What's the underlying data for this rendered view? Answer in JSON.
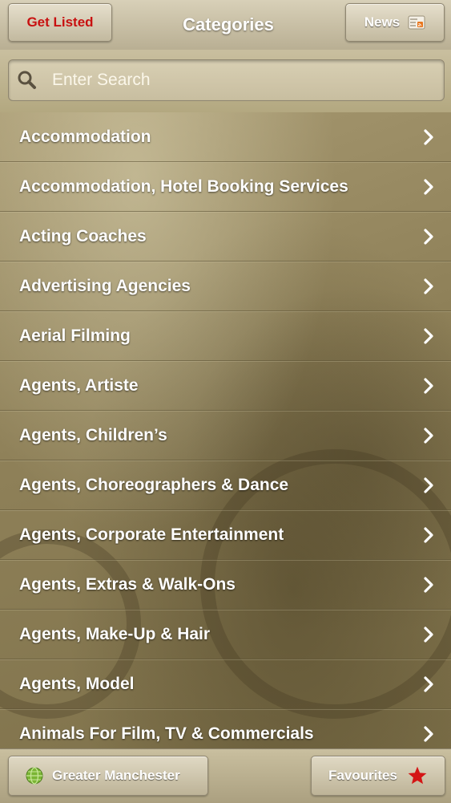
{
  "header": {
    "title": "Categories",
    "get_listed_label": "Get Listed",
    "news_label": "News",
    "news_icon": "rss-news-icon"
  },
  "search": {
    "placeholder": "Enter Search",
    "value": "",
    "icon": "search-icon"
  },
  "categories": [
    {
      "label": "Accommodation"
    },
    {
      "label": "Accommodation, Hotel Booking Services"
    },
    {
      "label": "Acting Coaches"
    },
    {
      "label": "Advertising Agencies"
    },
    {
      "label": "Aerial Filming"
    },
    {
      "label": "Agents, Artiste"
    },
    {
      "label": "Agents, Children’s"
    },
    {
      "label": "Agents, Choreographers & Dance"
    },
    {
      "label": "Agents, Corporate Entertainment"
    },
    {
      "label": "Agents, Extras & Walk-Ons"
    },
    {
      "label": "Agents, Make-Up & Hair"
    },
    {
      "label": "Agents, Model"
    },
    {
      "label": "Animals For Film, TV & Commercials"
    }
  ],
  "footer": {
    "location_label": "Greater Manchester",
    "location_icon": "globe-icon",
    "favourites_label": "Favourites",
    "favourites_icon": "star-icon"
  },
  "colors": {
    "get_listed_text": "#c81010",
    "star": "#d41515",
    "globe": "#6fae2a"
  }
}
